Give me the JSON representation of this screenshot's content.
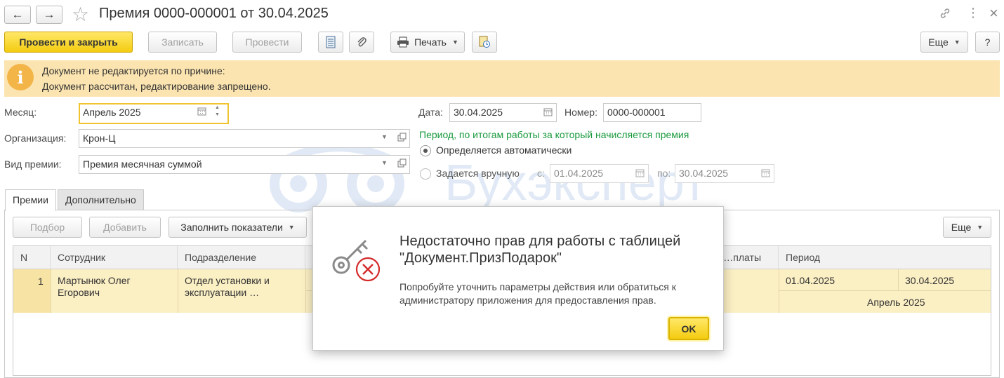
{
  "header": {
    "title": "Премия 0000-000001 от 30.04.2025",
    "back_icon": "←",
    "forward_icon": "→",
    "star_icon": "☆",
    "link_icon": "🔗",
    "more_icon": "⋮",
    "close_icon": "×"
  },
  "toolbar": {
    "post_close": "Провести и закрыть",
    "save": "Записать",
    "post": "Провести",
    "print": "Печать",
    "more": "Еще",
    "help": "?"
  },
  "banner": {
    "icon": "i",
    "line1": "Документ не редактируется по причине:",
    "line2": "Документ рассчитан, редактирование запрещено."
  },
  "form": {
    "month_label": "Месяц:",
    "month_value": "Апрель 2025",
    "org_label": "Организация:",
    "org_value": "Крон-Ц",
    "bonus_type_label": "Вид премии:",
    "bonus_type_value": "Премия месячная суммой",
    "date_label": "Дата:",
    "date_value": "30.04.2025",
    "number_label": "Номер:",
    "number_value": "0000-000001",
    "period_title": "Период, по итогам работы за который начисляется премия",
    "radio_auto": "Определяется автоматически",
    "radio_manual": "Задается вручную",
    "from_label": "с:",
    "from_value": "01.04.2025",
    "to_label": "по:",
    "to_value": "30.04.2025"
  },
  "tabs": [
    {
      "label": "Премии",
      "active": true
    },
    {
      "label": "Дополнительно",
      "active": false
    }
  ],
  "table_toolbar": {
    "pick": "Подбор",
    "add": "Добавить",
    "fill": "Заполнить показатели",
    "more": "Еще"
  },
  "table": {
    "columns": [
      "N",
      "Сотрудник",
      "Подразделение",
      "…платы",
      "Период"
    ],
    "rows": [
      {
        "n": "1",
        "employee_line1": "Мартынюк Олег",
        "employee_line2": "Егорович",
        "dept_line1": "Отдел установки и",
        "dept_line2": "эксплуатации …",
        "period_from": "01.04.2025",
        "period_to": "30.04.2025",
        "period_month": "Апрель 2025"
      }
    ]
  },
  "watermark": "Бухэксперт",
  "modal": {
    "title_line1": "Недостаточно прав для работы с таблицей",
    "title_line2": "\"Документ.ПризПодарок\"",
    "text_line1": "Попробуйте уточнить параметры действия или обратиться к",
    "text_line2": "администратору приложения для предоставления прав.",
    "ok": "OK"
  }
}
